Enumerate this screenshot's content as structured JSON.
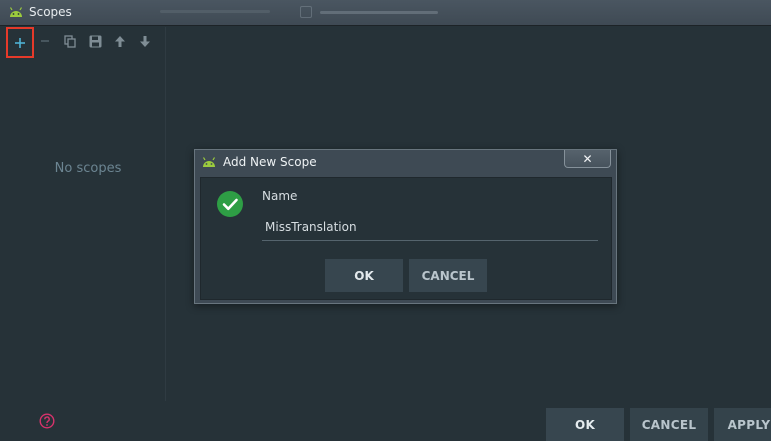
{
  "window": {
    "title": "Scopes",
    "background_hint": "Include test sources"
  },
  "toolbar": {
    "buttons": [
      {
        "icon": "plus-icon",
        "label": "+"
      },
      {
        "icon": "minus-icon",
        "label": "−"
      },
      {
        "icon": "copy-icon"
      },
      {
        "icon": "save-icon"
      },
      {
        "icon": "arrow-up-icon"
      },
      {
        "icon": "arrow-down-icon"
      }
    ]
  },
  "scopes_list": {
    "empty_text": "No scopes"
  },
  "dialog": {
    "title": "Add New Scope",
    "close_label": "✕",
    "name_label": "Name",
    "name_value": "MissTranslation",
    "ok_label": "OK",
    "cancel_label": "CANCEL"
  },
  "footer": {
    "ok_label": "OK",
    "cancel_label": "CANCEL",
    "apply_label": "APPLY"
  },
  "colors": {
    "background": "#263238",
    "highlight": "#e53a2a",
    "accent_green": "#2e9e45",
    "help_red": "#d6336c"
  }
}
